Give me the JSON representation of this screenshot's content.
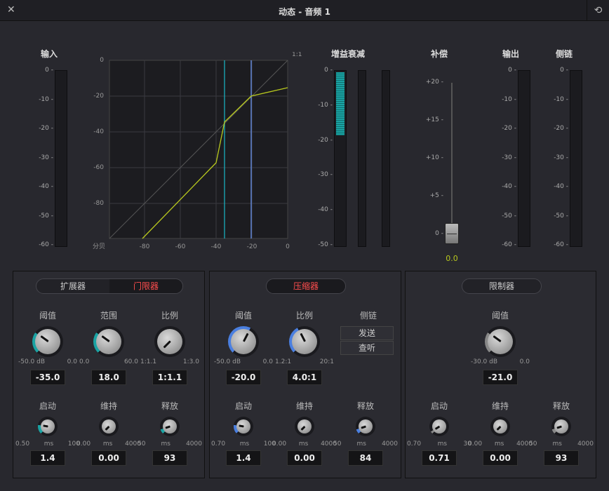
{
  "window": {
    "title": "动态 - 音频 1"
  },
  "meters": {
    "input_label": "输入",
    "gain_reduction_label": "增益衰减",
    "makeup_label": "补偿",
    "output_label": "输出",
    "sidechain_label": "侧链",
    "db_ticks": [
      "0",
      "-10",
      "-20",
      "-30",
      "-40",
      "-50",
      "-60"
    ],
    "gr_ticks": [
      "0",
      "-10",
      "-20",
      "-30",
      "-40",
      "-50"
    ],
    "makeup_ticks": [
      "+20",
      "+15",
      "+10",
      "+5",
      "0"
    ],
    "makeup_value": "0.0"
  },
  "graph": {
    "y_ticks": [
      "0",
      "-20",
      "-40",
      "-60",
      "-80"
    ],
    "x_ticks": [
      "-80",
      "-60",
      "-40",
      "-20",
      "0"
    ],
    "corner_label": "1:1",
    "unit_label": "分贝"
  },
  "expander": {
    "tab_expander": "扩展器",
    "tab_gate": "门限器",
    "threshold": {
      "label": "阈值",
      "min": "-50.0 dB",
      "max": "0.0",
      "value": "-35.0"
    },
    "range": {
      "label": "范围",
      "min": "0.0",
      "max": "60.0",
      "value": "18.0"
    },
    "ratio": {
      "label": "比例",
      "min": "1:1.1",
      "max": "1:3.0",
      "value": "1:1.1"
    },
    "attack": {
      "label": "启动",
      "min": "0.50",
      "unit": "ms",
      "max": "100",
      "value": "1.4"
    },
    "hold": {
      "label": "维持",
      "min": "0.00",
      "unit": "ms",
      "max": "4000",
      "value": "0.00"
    },
    "release": {
      "label": "释放",
      "min": "50",
      "unit": "ms",
      "max": "4000",
      "value": "93"
    }
  },
  "compressor": {
    "title": "压缩器",
    "threshold": {
      "label": "阈值",
      "min": "-50.0 dB",
      "max": "0.0",
      "value": "-20.0"
    },
    "ratio": {
      "label": "比例",
      "min": "1.2:1",
      "max": "20:1",
      "value": "4.0:1"
    },
    "sidechain": {
      "label": "侧链",
      "send": "发送",
      "listen": "查听"
    },
    "attack": {
      "label": "启动",
      "min": "0.70",
      "unit": "ms",
      "max": "100",
      "value": "1.4"
    },
    "hold": {
      "label": "维持",
      "min": "0.00",
      "unit": "ms",
      "max": "4000",
      "value": "0.00"
    },
    "release": {
      "label": "释放",
      "min": "50",
      "unit": "ms",
      "max": "4000",
      "value": "84"
    }
  },
  "limiter": {
    "title": "限制器",
    "threshold": {
      "label": "阈值",
      "min": "-30.0 dB",
      "max": "0.0",
      "value": "-21.0"
    },
    "attack": {
      "label": "启动",
      "min": "0.70",
      "unit": "ms",
      "max": "30",
      "value": "0.71"
    },
    "hold": {
      "label": "维持",
      "min": "0.00",
      "unit": "ms",
      "max": "4000",
      "value": "0.00"
    },
    "release": {
      "label": "释放",
      "min": "50",
      "unit": "ms",
      "max": "4000",
      "value": "93"
    }
  },
  "colors": {
    "accent_teal": "#1aa3a3",
    "accent_blue": "#4a7fe0",
    "gate_red": "#ff4d4d",
    "curve": "#b8c81e"
  }
}
